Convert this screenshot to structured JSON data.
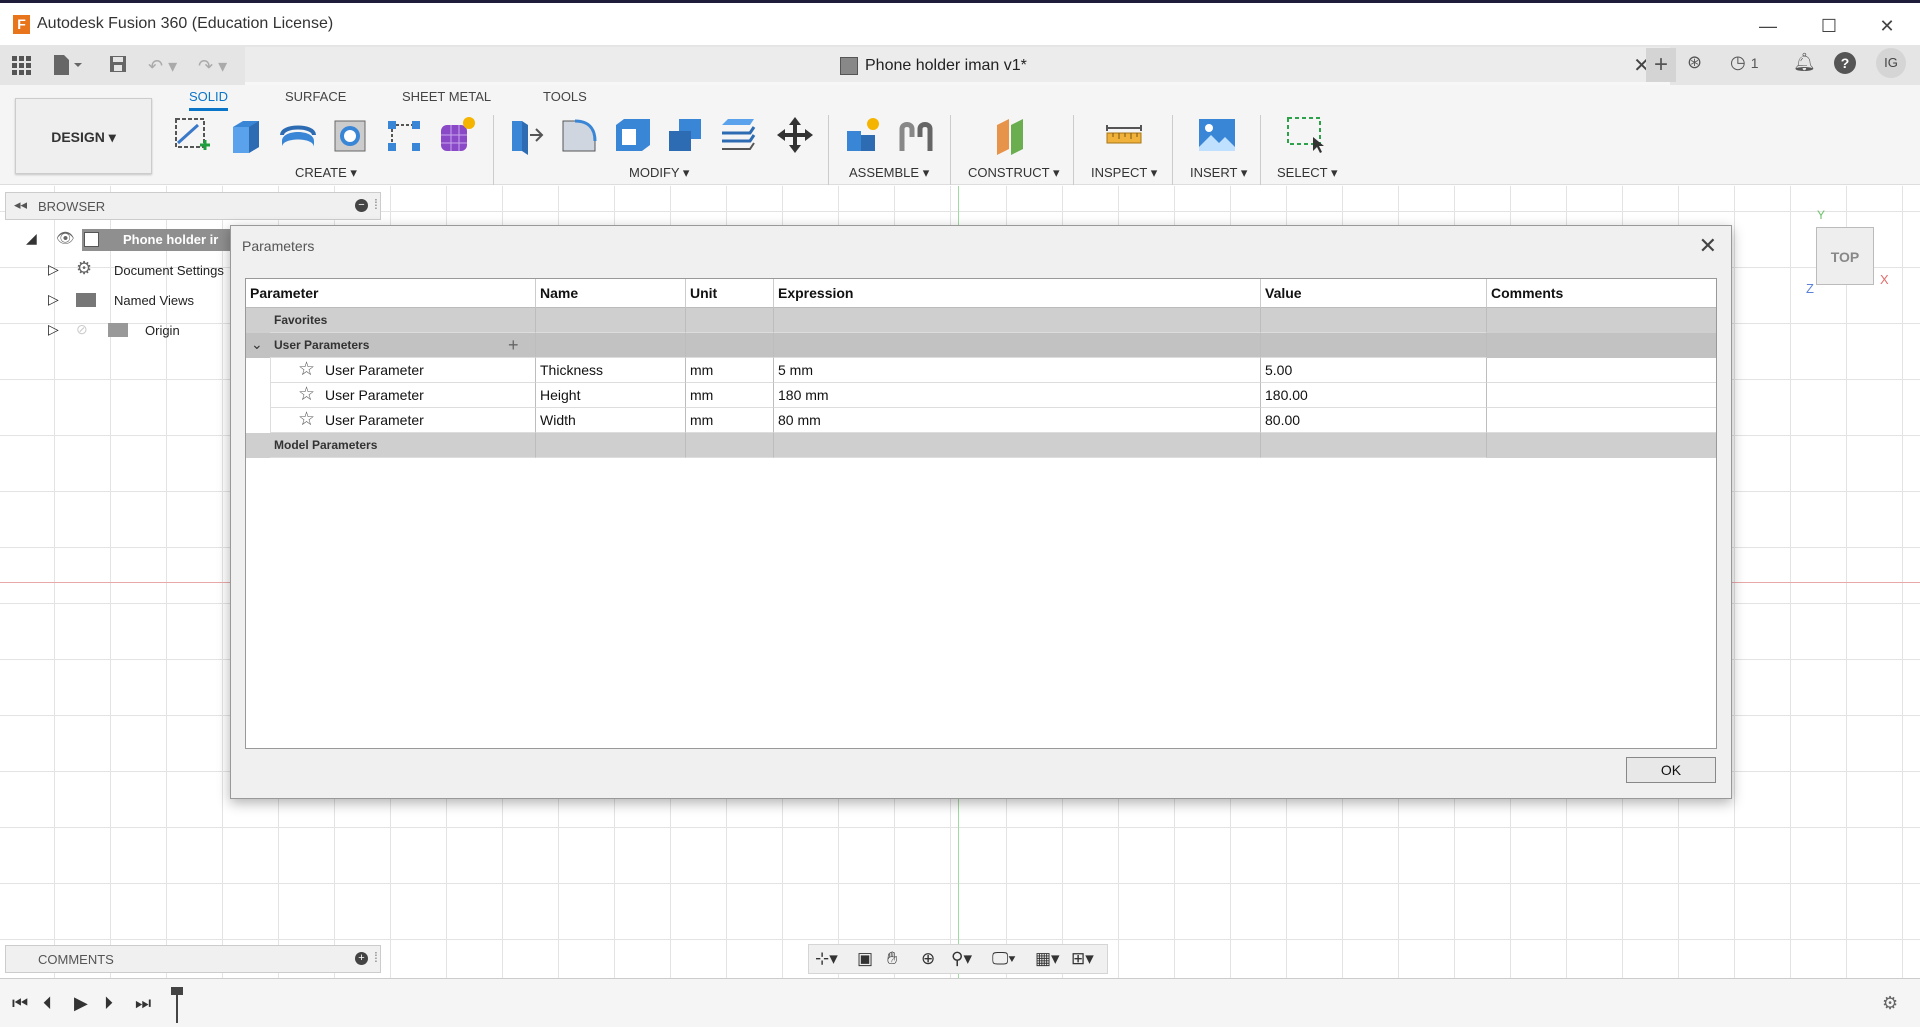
{
  "app": {
    "logo_letter": "F",
    "title": "Autodesk Fusion 360 (Education License)"
  },
  "window_controls": {
    "minimize": "—",
    "maximize": "☐",
    "close": "✕"
  },
  "doc_tab": {
    "title": "Phone holder iman v1*",
    "close": "✕",
    "jobs_count": "1",
    "user_initials": "IG"
  },
  "ribbon": {
    "tabs": [
      "SOLID",
      "SURFACE",
      "SHEET METAL",
      "TOOLS"
    ],
    "active_tab": "SOLID",
    "workspace": "DESIGN ▾",
    "groups": [
      "CREATE ▾",
      "MODIFY ▾",
      "ASSEMBLE ▾",
      "CONSTRUCT ▾",
      "INSPECT ▾",
      "INSERT ▾",
      "SELECT ▾"
    ]
  },
  "browser": {
    "title": "BROWSER",
    "root": "Phone holder ir",
    "items": [
      "Document Settings",
      "Named Views",
      "Origin"
    ]
  },
  "viewcube": {
    "face": "TOP",
    "x_label": "X",
    "y_label": "Y",
    "z_label": "Z"
  },
  "dialog": {
    "title": "Parameters",
    "close": "✕",
    "columns": [
      "Parameter",
      "Name",
      "Unit",
      "Expression",
      "Value",
      "Comments"
    ],
    "favorites_label": "Favorites",
    "user_params_label": "User Parameters",
    "add_symbol": "+",
    "rows": [
      {
        "parameter": "User Parameter",
        "name": "Thickness",
        "unit": "mm",
        "expression": "5 mm",
        "value": "5.00",
        "comments": ""
      },
      {
        "parameter": "User Parameter",
        "name": "Height",
        "unit": "mm",
        "expression": "180 mm",
        "value": "180.00",
        "comments": ""
      },
      {
        "parameter": "User Parameter",
        "name": "Width",
        "unit": "mm",
        "expression": "80 mm",
        "value": "80.00",
        "comments": ""
      }
    ],
    "model_params_label": "Model Parameters",
    "ok_label": "OK"
  },
  "comments_panel": {
    "title": "COMMENTS"
  }
}
